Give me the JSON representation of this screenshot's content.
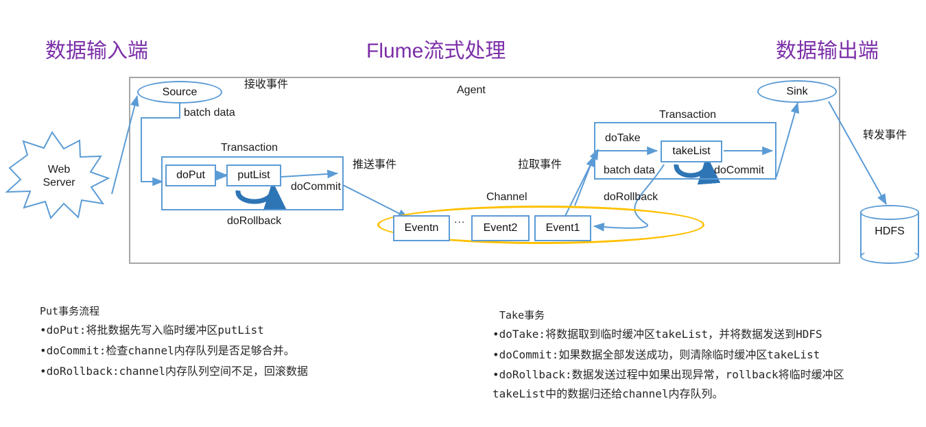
{
  "titles": {
    "left": "数据输入端",
    "center": "Flume流式处理",
    "right": "数据输出端"
  },
  "colors": {
    "title_purple": "#7B2FA8",
    "node_blue": "#5B9BD5",
    "channel_amber": "#FFC000",
    "agent_border_gray": "#A6A6A6",
    "loop_arrow_blue": "#2E75B6"
  },
  "diagram": {
    "agent_label": "Agent",
    "web_server": "Web\nServer",
    "web_server_line1": "Web",
    "web_server_line2": "Server",
    "source": "Source",
    "sink": "Sink",
    "hdfs": "HDFS",
    "channel_label": "Channel",
    "receive_event": "接收事件",
    "push_event": "推送事件",
    "pull_event": "拉取事件",
    "forward_event": "转发事件",
    "batch_data_left": "batch data",
    "batch_data_right": "batch data",
    "put_transaction": {
      "title": "Transaction",
      "step1": "doPut",
      "step2": "putList",
      "commit": "doCommit",
      "rollback": "doRollback"
    },
    "take_transaction": {
      "title": "Transaction",
      "take": "doTake",
      "list": "takeList",
      "commit": "doCommit",
      "rollback": "doRollback"
    },
    "events": [
      {
        "label": "Eventn"
      },
      {
        "label": "…"
      },
      {
        "label": "Event2"
      },
      {
        "label": "Event1"
      }
    ],
    "event_ellipsis": "..."
  },
  "notes": {
    "put": {
      "heading": "Put事务流程",
      "lines": [
        "•doPut:将批数据先写入临时缓冲区putList",
        "•doCommit:检查channel内存队列是否足够合并。",
        "•doRollback:channel内存队列空间不足，回滚数据"
      ]
    },
    "take": {
      "heading": "Take事务",
      "lines": [
        "•doTake:将数据取到临时缓冲区takeList，并将数据发送到HDFS",
        "•doCommit:如果数据全部发送成功，则清除临时缓冲区takeList",
        "•doRollback:数据发送过程中如果出现异常，rollback将临时缓冲区takeList中的数据归还给channel内存队列。"
      ]
    }
  }
}
